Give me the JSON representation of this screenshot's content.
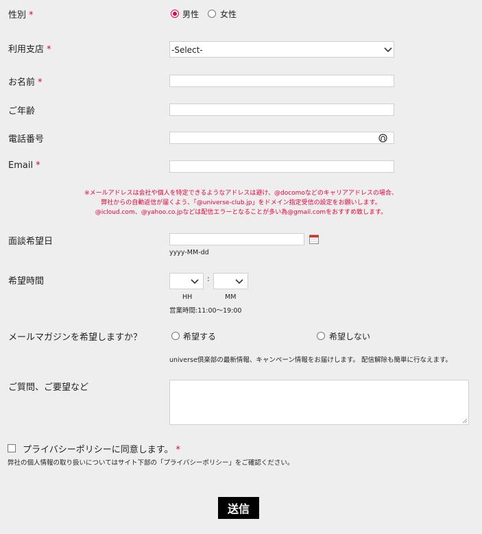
{
  "fields": {
    "gender": {
      "label": "性別",
      "required": "*",
      "options": [
        "男性",
        "女性"
      ],
      "selected": "男性"
    },
    "branch": {
      "label": "利用支店",
      "required": "*",
      "value": "-Select-"
    },
    "name": {
      "label": "お名前",
      "required": "*",
      "value": ""
    },
    "age": {
      "label": "ご年齢",
      "value": ""
    },
    "phone": {
      "label": "電話番号",
      "value": ""
    },
    "email": {
      "label": "Email",
      "required": "*",
      "value": ""
    },
    "email_note": [
      "※メールアドレスは会社や個人を特定できるようなアドレスは避け、@docomoなどのキャリアアドレスの場合、",
      "弊社からの自動返信が届くよう、「@universe-club.jp」をドメイン指定受信の設定をお願いします。",
      "@icloud.com、@yahoo.co.jpなどは配信エラーとなることが多い為@gmail.comをおすすめ致します。"
    ],
    "date": {
      "label": "面談希望日",
      "value": "",
      "hint": "yyyy-MM-dd"
    },
    "time": {
      "label": "希望時間",
      "separator": ":",
      "hour_hint": "HH",
      "minute_hint": "MM",
      "hours_note": "営業時間:11:00～19:00"
    },
    "newsletter": {
      "label": "メールマガジンを希望しますか？",
      "options": [
        "希望する",
        "希望しない"
      ],
      "selected": "",
      "note": "universe倶楽部の最新情報、キャンペーン情報をお届けします。 配信解除も簡単に行なえます。"
    },
    "comments": {
      "label": "ご質問、ご要望など",
      "value": ""
    },
    "privacy": {
      "label": "プライバシーポリシーに同意します。",
      "required": "*",
      "checked": false,
      "note": "弊社の個人情報の取り扱いについてはサイト下部の「プライバシーポリシー」をご確認ください。"
    }
  },
  "submit_label": "送信",
  "colors": {
    "required": "#e6003a",
    "radio_selected": "#e6004d",
    "submit_bg": "#000000"
  }
}
